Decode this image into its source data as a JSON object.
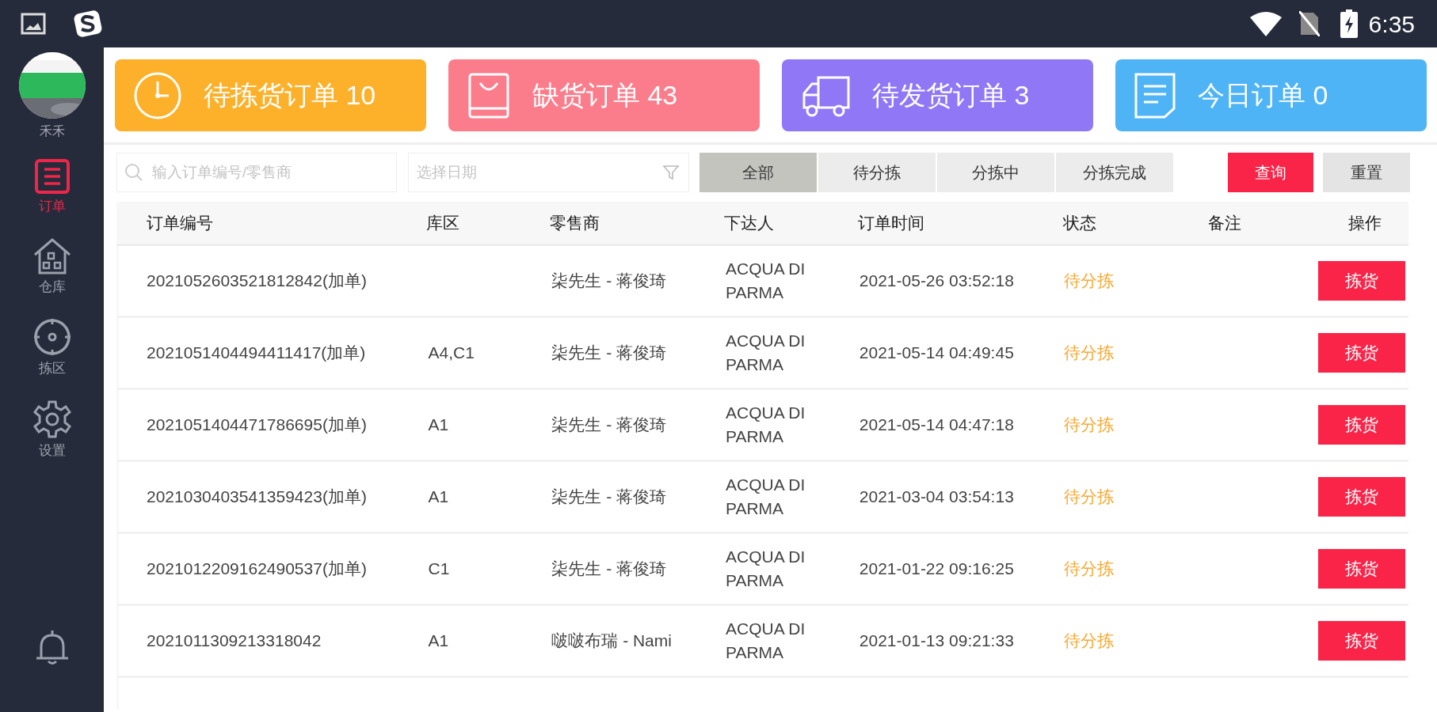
{
  "status_bar": {
    "time": "6:35"
  },
  "sidebar": {
    "user_name": "禾禾",
    "items": [
      {
        "kind": "orders",
        "label": "订单",
        "selected": true
      },
      {
        "kind": "warehouse",
        "label": "仓库",
        "selected": false
      },
      {
        "kind": "area",
        "label": "拣区",
        "selected": false
      },
      {
        "kind": "settings",
        "label": "设置",
        "selected": false
      }
    ]
  },
  "summary_cards": [
    {
      "kind": "clock",
      "label": "待拣货订单",
      "count": "10",
      "color": "#fdb12b"
    },
    {
      "kind": "bag",
      "label": "缺货订单",
      "count": "43",
      "color": "#fb7d8b"
    },
    {
      "kind": "truck",
      "label": "待发货订单",
      "count": "3",
      "color": "#8f77f6"
    },
    {
      "kind": "note",
      "label": "今日订单",
      "count": "0",
      "color": "#4fb4f5"
    }
  ],
  "filters": {
    "search": {
      "placeholder": "输入订单编号/零售商"
    },
    "date": {
      "placeholder": "选择日期"
    },
    "segments": [
      {
        "label": "全部",
        "selected": true
      },
      {
        "label": "待分拣",
        "selected": false
      },
      {
        "label": "分拣中",
        "selected": false
      },
      {
        "label": "分拣完成",
        "selected": false
      }
    ],
    "buttons": [
      {
        "kind": "query",
        "label": "查询"
      },
      {
        "kind": "reset",
        "label": "重置"
      }
    ]
  },
  "table": {
    "columns": [
      "订单编号",
      "库区",
      "零售商",
      "下达人",
      "订单时间",
      "状态",
      "备注",
      "操作"
    ],
    "rows": [
      {
        "order_no": "2021052603521812842(加单)",
        "zone": "",
        "retailer": "柒先生 - 蒋俊琦",
        "issuer": "ACQUA DI PARMA",
        "time": "2021-05-26 03:52:18",
        "status": "待分拣",
        "action": "拣货"
      },
      {
        "order_no": "2021051404494411417(加单)",
        "zone": "A4,C1",
        "retailer": "柒先生 - 蒋俊琦",
        "issuer": "ACQUA DI PARMA",
        "time": "2021-05-14 04:49:45",
        "status": "待分拣",
        "action": "拣货"
      },
      {
        "order_no": "2021051404471786695(加单)",
        "zone": "A1",
        "retailer": "柒先生 - 蒋俊琦",
        "issuer": "ACQUA DI PARMA",
        "time": "2021-05-14 04:47:18",
        "status": "待分拣",
        "action": "拣货"
      },
      {
        "order_no": "2021030403541359423(加单)",
        "zone": "A1",
        "retailer": "柒先生 - 蒋俊琦",
        "issuer": "ACQUA DI PARMA",
        "time": "2021-03-04 03:54:13",
        "status": "待分拣",
        "action": "拣货"
      },
      {
        "order_no": "2021012209162490537(加单)",
        "zone": "C1",
        "retailer": "柒先生 - 蒋俊琦",
        "issuer": "ACQUA DI PARMA",
        "time": "2021-01-22 09:16:25",
        "status": "待分拣",
        "action": "拣货"
      },
      {
        "order_no": "2021011309213318042",
        "zone": "A1",
        "retailer": "啵啵布瑞 - Nami",
        "issuer": "ACQUA DI PARMA",
        "time": "2021-01-13 09:21:33",
        "status": "待分拣",
        "action": "拣货"
      }
    ]
  }
}
